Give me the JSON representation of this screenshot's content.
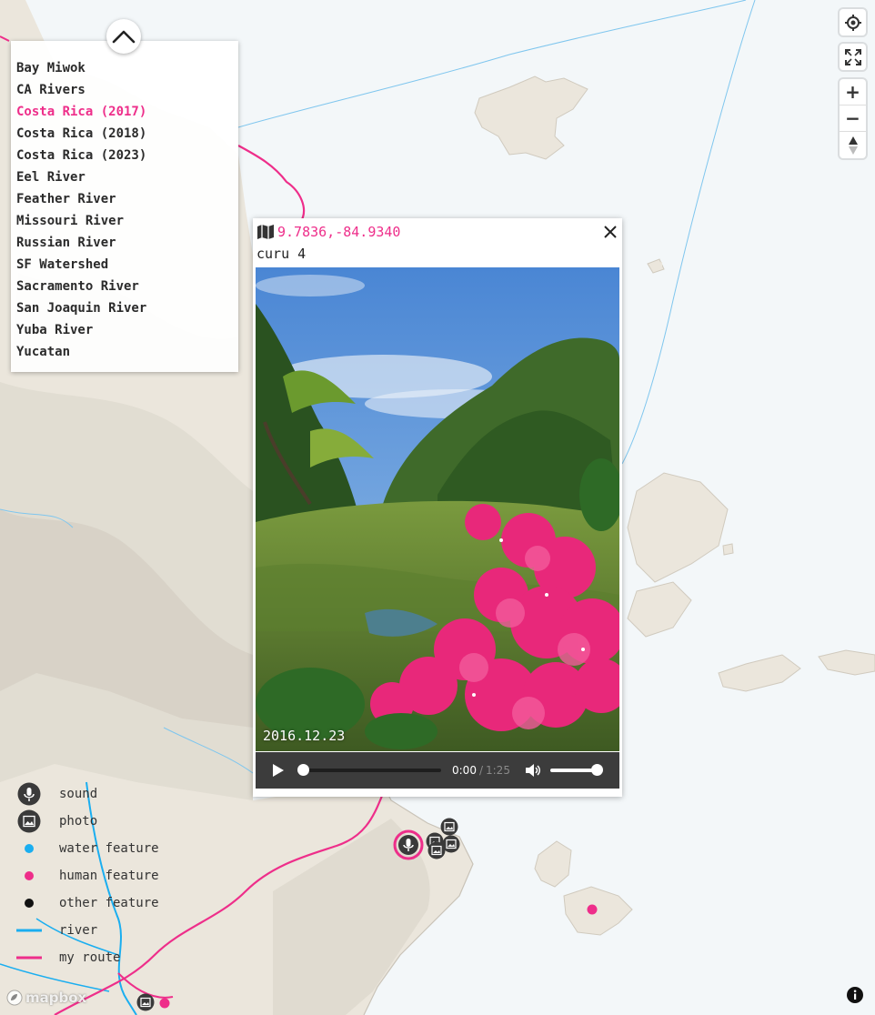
{
  "projects": {
    "items": [
      {
        "label": "Bay Miwok",
        "active": false
      },
      {
        "label": "CA Rivers",
        "active": false
      },
      {
        "label": "Costa Rica (2017)",
        "active": true
      },
      {
        "label": "Costa Rica (2018)",
        "active": false
      },
      {
        "label": "Costa Rica (2023)",
        "active": false
      },
      {
        "label": "Eel River",
        "active": false
      },
      {
        "label": "Feather River",
        "active": false
      },
      {
        "label": "Missouri River",
        "active": false
      },
      {
        "label": "Russian River",
        "active": false
      },
      {
        "label": "SF Watershed",
        "active": false
      },
      {
        "label": "Sacramento River",
        "active": false
      },
      {
        "label": "San Joaquin River",
        "active": false
      },
      {
        "label": "Yuba River",
        "active": false
      },
      {
        "label": "Yucatan",
        "active": false
      }
    ],
    "toggle_icon": "chevron-up-icon"
  },
  "controls": {
    "geolocate_icon": "crosshair-icon",
    "fullscreen_icon": "expand-icon",
    "zoom_in_label": "+",
    "zoom_out_label": "−",
    "compass_icon": "compass-icon"
  },
  "popup": {
    "coords": "9.7836,-84.9340",
    "title": "curu 4",
    "photo_date": "2016.12.23",
    "audio": {
      "current_time": "0:00",
      "separator": "/",
      "duration": "1:25",
      "progress": 0,
      "volume": 1.0
    }
  },
  "legend": {
    "items": [
      {
        "label": "sound",
        "icon": "microphone-icon"
      },
      {
        "label": "photo",
        "icon": "photo-icon"
      },
      {
        "label": "water feature",
        "icon": "dot-icon",
        "color": "#1aaef0"
      },
      {
        "label": "human feature",
        "icon": "dot-icon",
        "color": "#ee2e8a"
      },
      {
        "label": "other feature",
        "icon": "dot-icon",
        "color": "#111111"
      },
      {
        "label": "river",
        "icon": "line-icon",
        "color": "#1aaef0"
      },
      {
        "label": "my route",
        "icon": "line-icon",
        "color": "#ee2e8a"
      }
    ]
  },
  "attribution": {
    "logo_text": "mapbox",
    "info_icon": "info-icon"
  },
  "colors": {
    "accent": "#ee2e8a",
    "water": "#f3f7f9",
    "land": "#ece7de",
    "river": "#1aaef0"
  }
}
